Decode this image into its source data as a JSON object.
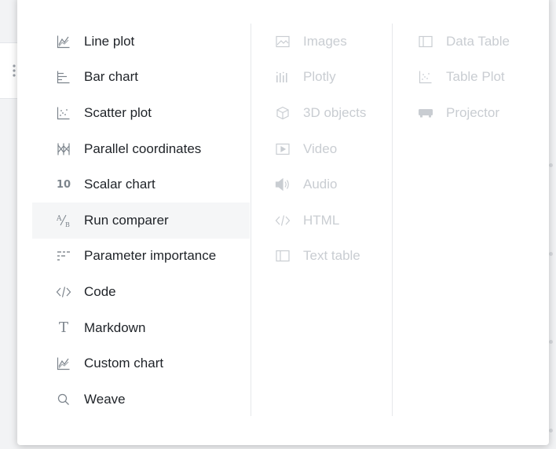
{
  "colors": {
    "text": "#1f2328",
    "disabled_text": "#c9cdd2",
    "icon": "#7c848c",
    "disabled_icon": "#c9cdd2",
    "hover_bg": "#f5f6f7"
  },
  "menu": {
    "col1": [
      {
        "label": "Line plot",
        "icon": "line-plot-icon"
      },
      {
        "label": "Bar chart",
        "icon": "bar-chart-icon"
      },
      {
        "label": "Scatter plot",
        "icon": "scatter-plot-icon"
      },
      {
        "label": "Parallel coordinates",
        "icon": "parallel-coordinates-icon"
      },
      {
        "label": "Scalar chart",
        "icon": "scalar-chart-icon",
        "glyph": "10"
      },
      {
        "label": "Run comparer",
        "icon": "run-comparer-icon",
        "glyph": "A/B"
      },
      {
        "label": "Parameter importance",
        "icon": "parameter-importance-icon"
      },
      {
        "label": "Code",
        "icon": "code-icon"
      },
      {
        "label": "Markdown",
        "icon": "markdown-icon",
        "glyph": "T"
      },
      {
        "label": "Custom chart",
        "icon": "custom-chart-icon"
      },
      {
        "label": "Weave",
        "icon": "search-icon"
      }
    ],
    "col2": [
      {
        "label": "Images",
        "icon": "image-icon"
      },
      {
        "label": "Plotly",
        "icon": "plotly-icon"
      },
      {
        "label": "3D objects",
        "icon": "cube-icon"
      },
      {
        "label": "Video",
        "icon": "video-icon"
      },
      {
        "label": "Audio",
        "icon": "audio-icon"
      },
      {
        "label": "HTML",
        "icon": "html-icon"
      },
      {
        "label": "Text table",
        "icon": "text-table-icon"
      }
    ],
    "col3": [
      {
        "label": "Data Table",
        "icon": "data-table-icon"
      },
      {
        "label": "Table Plot",
        "icon": "table-plot-icon"
      },
      {
        "label": "Projector",
        "icon": "projector-icon"
      }
    ]
  }
}
